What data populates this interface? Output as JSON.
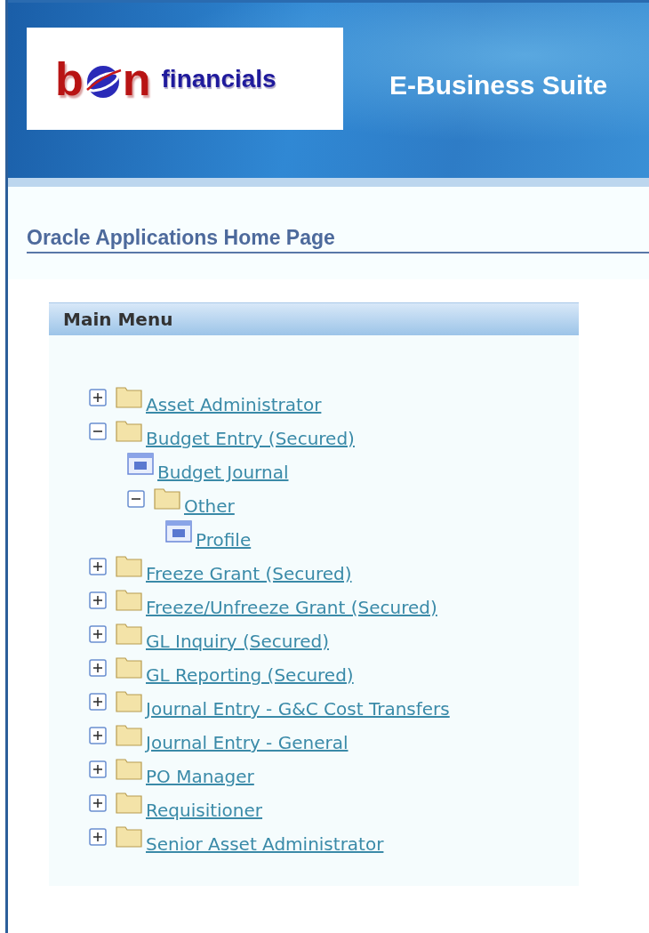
{
  "header": {
    "logo": {
      "mark_start": "b",
      "mark_end": "n",
      "word": "financials"
    },
    "title": "E-Business Suite"
  },
  "page_title": "Oracle Applications Home Page",
  "main_menu": {
    "title": "Main Menu",
    "items": [
      {
        "kind": "folder",
        "label": "Asset Administrator",
        "expanded": false
      },
      {
        "kind": "folder",
        "label": "Budget Entry (Secured)",
        "expanded": true,
        "children": [
          {
            "kind": "function",
            "label": "Budget Journal"
          },
          {
            "kind": "folder",
            "label": "Other",
            "expanded": true,
            "children": [
              {
                "kind": "function",
                "label": "Profile"
              }
            ]
          }
        ]
      },
      {
        "kind": "folder",
        "label": "Freeze Grant (Secured)",
        "expanded": false
      },
      {
        "kind": "folder",
        "label": "Freeze/Unfreeze Grant (Secured)",
        "expanded": false
      },
      {
        "kind": "folder",
        "label": "GL Inquiry (Secured)",
        "expanded": false
      },
      {
        "kind": "folder",
        "label": "GL Reporting (Secured)",
        "expanded": false
      },
      {
        "kind": "folder",
        "label": "Journal Entry - G&C Cost Transfers",
        "expanded": false
      },
      {
        "kind": "folder",
        "label": "Journal Entry - General",
        "expanded": false
      },
      {
        "kind": "folder",
        "label": "PO Manager",
        "expanded": false
      },
      {
        "kind": "folder",
        "label": "Requisitioner",
        "expanded": false
      },
      {
        "kind": "folder",
        "label": "Senior Asset Administrator",
        "expanded": false
      }
    ]
  }
}
